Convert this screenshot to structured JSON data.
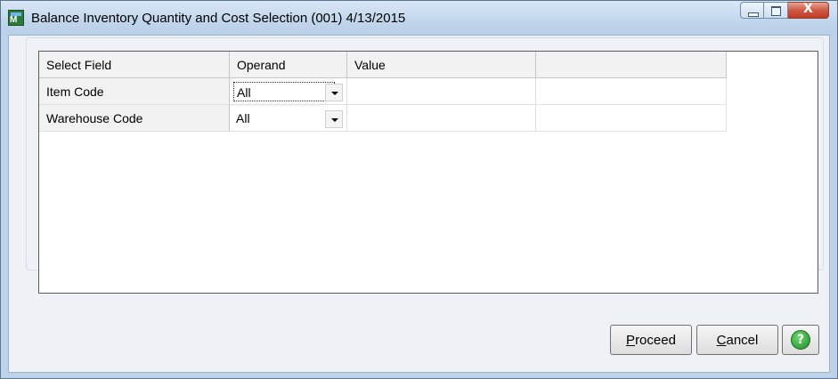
{
  "window": {
    "title": "Balance Inventory Quantity and Cost Selection (001) 4/13/2015",
    "icon": "mas90-app-icon",
    "icon_letter": "M",
    "controls": {
      "minimize": "minimize-icon",
      "maximize": "maximize-icon",
      "close": "close-icon",
      "close_glyph": "X"
    }
  },
  "grid": {
    "columns": [
      "Select Field",
      "Operand",
      "Value",
      ""
    ],
    "rows": [
      {
        "field": "Item Code",
        "operand": "All",
        "value": "",
        "extra": ""
      },
      {
        "field": "Warehouse Code",
        "operand": "All",
        "value": "",
        "extra": ""
      }
    ]
  },
  "buttons": {
    "proceed": {
      "accel": "P",
      "rest": "roceed"
    },
    "cancel": {
      "accel": "C",
      "rest": "ancel"
    },
    "help": {
      "glyph": "?",
      "icon": "help-icon"
    }
  },
  "colors": {
    "close_button": "#c23a22",
    "help_icon": "#1f8a2a"
  }
}
